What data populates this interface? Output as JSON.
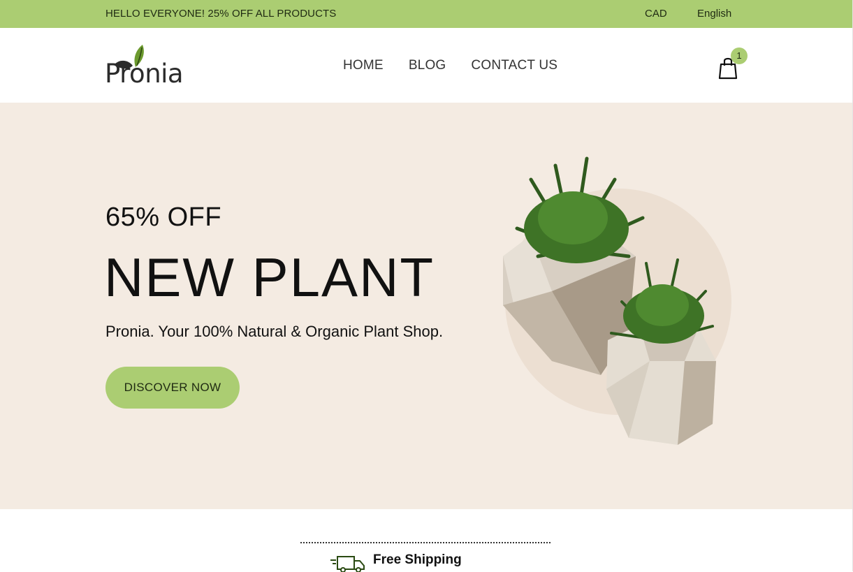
{
  "topbar": {
    "promo": "HELLO EVERYONE! 25% OFF ALL PRODUCTS",
    "currency": "CAD",
    "language": "English"
  },
  "header": {
    "logo_text": "Pronia",
    "nav": [
      {
        "label": "HOME"
      },
      {
        "label": "BLOG"
      },
      {
        "label": "CONTACT US"
      }
    ],
    "cart_count": "1"
  },
  "hero": {
    "offer": "65% OFF",
    "title": "NEW PLANT",
    "tagline": "Pronia. Your 100% Natural & Organic Plant Shop.",
    "cta_label": "DISCOVER NOW",
    "image": "potted-plants-illustration"
  },
  "features": {
    "shipping_label": "Free Shipping",
    "shipping_icon": "truck-icon"
  },
  "colors": {
    "accent": "#abcd72",
    "hero_bg": "#f4ebe2",
    "text": "#111111"
  }
}
